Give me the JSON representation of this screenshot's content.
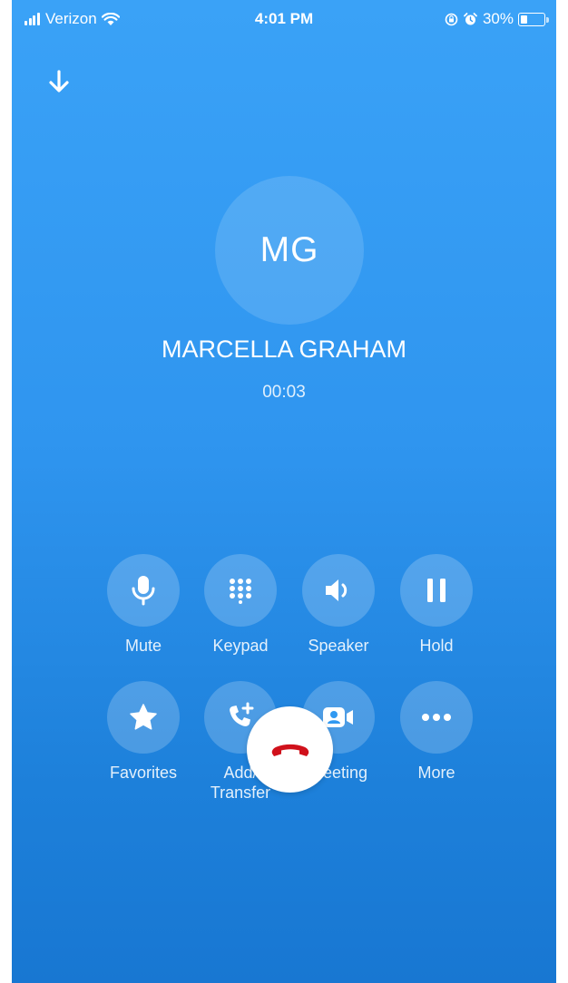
{
  "status_bar": {
    "carrier": "Verizon",
    "time": "4:01 PM",
    "battery_percent": "30%",
    "battery_level": 0.3,
    "icons": [
      "signal-icon",
      "wifi-icon",
      "rotation-lock-icon",
      "alarm-icon",
      "battery-icon"
    ]
  },
  "header": {
    "minimize_icon": "arrow-down-icon"
  },
  "caller": {
    "initials": "MG",
    "name": "MARCELLA GRAHAM",
    "duration": "00:03"
  },
  "controls": [
    {
      "label": "Mute",
      "icon": "microphone-icon"
    },
    {
      "label": "Keypad",
      "icon": "keypad-icon"
    },
    {
      "label": "Speaker",
      "icon": "speaker-icon"
    },
    {
      "label": "Hold",
      "icon": "pause-icon"
    },
    {
      "label": "Favorites",
      "icon": "star-icon"
    },
    {
      "label": "Add/\nTransfer",
      "icon": "add-call-icon"
    },
    {
      "label": "Meeting",
      "icon": "video-meeting-icon"
    },
    {
      "label": "More",
      "icon": "more-icon"
    }
  ],
  "end_call": {
    "icon": "hang-up-icon",
    "color": "#d0111b"
  },
  "colors": {
    "background_top": "#3aa2f7",
    "background_bottom": "#1877d2",
    "end_call_red": "#d0111b"
  }
}
